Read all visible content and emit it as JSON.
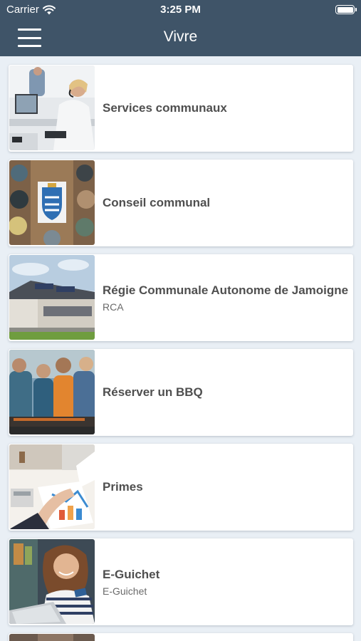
{
  "status_bar": {
    "carrier": "Carrier",
    "time": "3:25 PM"
  },
  "nav": {
    "title": "Vivre",
    "menu_icon": "hamburger-menu-icon"
  },
  "items": [
    {
      "title": "Services communaux",
      "subtitle": ""
    },
    {
      "title": "Conseil communal",
      "subtitle": ""
    },
    {
      "title": "Régie Communale Autonome de Jamoigne",
      "subtitle": "RCA"
    },
    {
      "title": "Réserver un BBQ",
      "subtitle": ""
    },
    {
      "title": "Primes",
      "subtitle": ""
    },
    {
      "title": "E-Guichet",
      "subtitle": "E-Guichet"
    }
  ],
  "colors": {
    "header": "#3f5468",
    "background": "#e9eff5",
    "card": "#ffffff",
    "text": "#4f4f4f"
  }
}
